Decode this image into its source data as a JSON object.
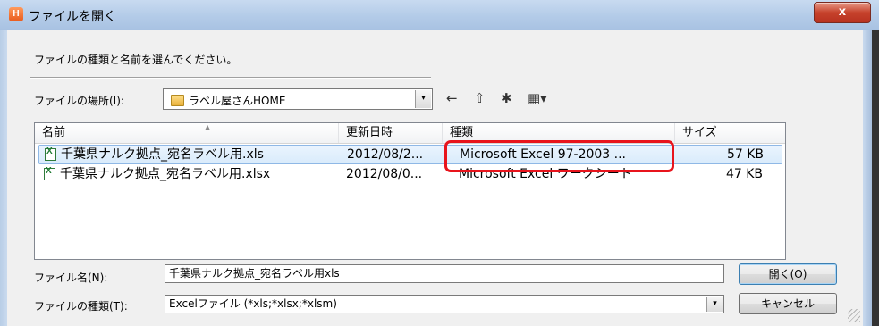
{
  "window": {
    "title": "ファイルを開く",
    "app_icon": "H",
    "close_label": "x"
  },
  "instruction": "ファイルの種類と名前を選んでください。",
  "location": {
    "label": "ファイルの場所(I):",
    "value": "ラベル屋さんHOME",
    "dropdown_glyph": "▾"
  },
  "toolbar": {
    "back_glyph": "←",
    "up_folder_glyph": "⇧",
    "new_folder_glyph": "✱",
    "view_menu_glyph": "▦▾"
  },
  "list": {
    "columns": [
      "名前",
      "更新日時",
      "種類",
      "サイズ"
    ],
    "rows": [
      {
        "name": "千葉県ナルク拠点_宛名ラベル用.xls",
        "date": "2012/08/2...",
        "type": "Microsoft Excel 97-2003 ...",
        "size": "57 KB",
        "selected": true
      },
      {
        "name": "千葉県ナルク拠点_宛名ラベル用.xlsx",
        "date": "2012/08/0...",
        "type": "Microsoft Excel ワークシート",
        "size": "47 KB",
        "selected": false
      }
    ]
  },
  "filename": {
    "label": "ファイル名(N):",
    "value": "千葉県ナルク拠点_宛名ラベル用xls"
  },
  "filetype": {
    "label": "ファイルの種類(T):",
    "value": "Excelファイル (*xls;*xlsx;*xlsm)",
    "dropdown_glyph": "▾"
  },
  "buttons": {
    "open": "開く(O)",
    "cancel": "キャンセル"
  },
  "colors": {
    "highlight": "#e8141c",
    "selection": "#d9ebfb"
  }
}
